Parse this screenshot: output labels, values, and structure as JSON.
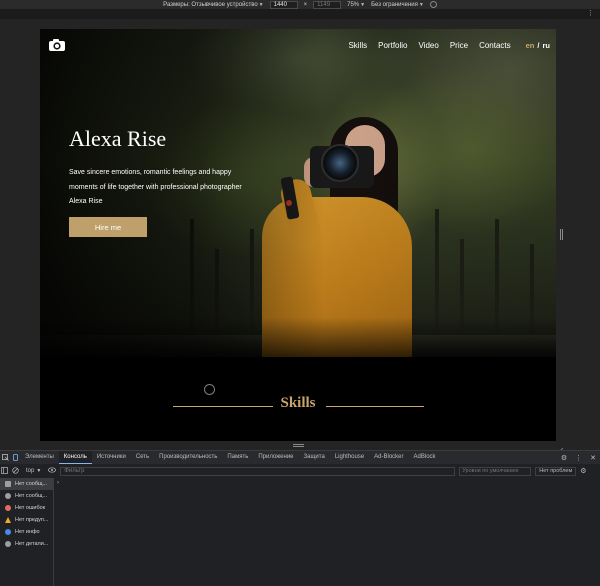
{
  "device_toolbar": {
    "dimensions_label": "Размеры: Отзывчивое устройство",
    "width": "1440",
    "height": "1149",
    "times": "×",
    "zoom": "75%",
    "throttle": "Без ограничения"
  },
  "site": {
    "nav": [
      "Skills",
      "Portfolio",
      "Video",
      "Price",
      "Contacts"
    ],
    "lang_en": "en",
    "lang_sep": "/",
    "lang_ru": "ru",
    "hero_title": "Alexa Rise",
    "hero_text": "Save sincere emotions, romantic feelings and happy moments of life together with professional photographer Alexa Rise",
    "hire_button": "Hire me",
    "skills_title": "Skills",
    "accent_color": "#c9a66b"
  },
  "devtools": {
    "tabs": [
      "Элементы",
      "Консоль",
      "Источники",
      "Сеть",
      "Производительность",
      "Память",
      "Приложение",
      "Защита",
      "Lighthouse",
      "Ad-Blocker",
      "AdBlock"
    ],
    "active_tab": "Консоль",
    "context": "top",
    "filter_placeholder": "Фильтр",
    "levels": "Уровни по умолчанию",
    "issues": "Нет проблем",
    "sidebar": [
      {
        "label": "Нет сообщ...",
        "icon": "list-icon",
        "color": "#bdbdbd"
      },
      {
        "label": "Нет сообщ...",
        "icon": "user-icon",
        "color": "#bdbdbd"
      },
      {
        "label": "Нет ошибок",
        "icon": "error-icon",
        "color": "#e46962"
      },
      {
        "label": "Нет предуп...",
        "icon": "warning-icon",
        "color": "#f2ab26"
      },
      {
        "label": "Нет инфо",
        "icon": "info-icon",
        "color": "#4a88ee"
      },
      {
        "label": "Нет детали...",
        "icon": "verbose-icon",
        "color": "#9e9e9e"
      }
    ],
    "prompt": "›"
  }
}
